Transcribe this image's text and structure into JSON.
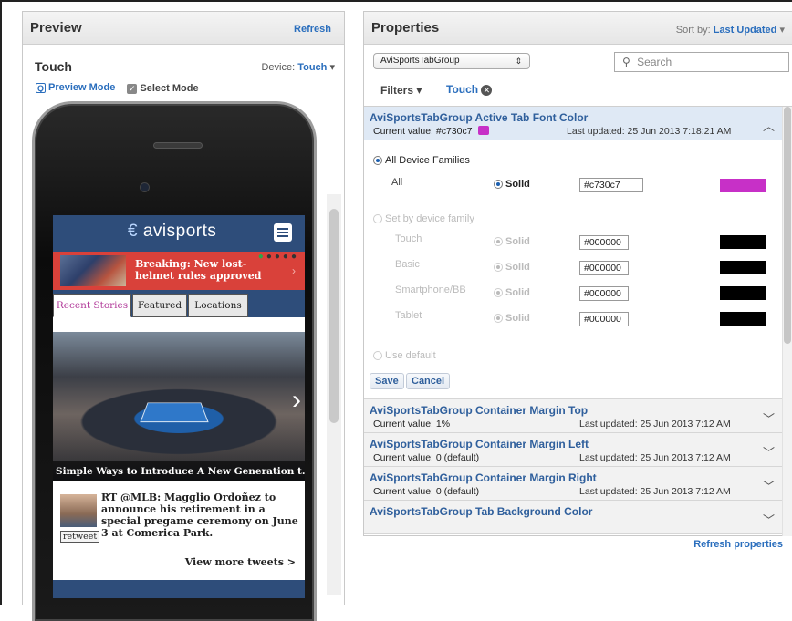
{
  "preview": {
    "title": "Preview",
    "refresh_label": "Refresh",
    "device_label": "Touch",
    "device_prefix": "Device:",
    "device_value": "Touch",
    "modes": [
      {
        "label": "Preview Mode"
      },
      {
        "label": "Select Mode"
      }
    ],
    "app": {
      "logo": "avisports",
      "breaking_text": "Breaking: New lost-helmet rules approved",
      "tabs": [
        "Recent Stories",
        "Featured",
        "Locations"
      ],
      "hero_caption": "Simple Ways to Introduce A New Generation t...",
      "tweet_text": "RT @MLB: Magglio Ordoñez to announce his retirement in a special pregame ceremony on June 3 at Comerica Park.",
      "retweet_label": "retweet",
      "more_tweets": "View more tweets >"
    }
  },
  "properties": {
    "title": "Properties",
    "sort_prefix": "Sort by:",
    "sort_value": "Last Updated",
    "tabgroup_select": "AviSportsTabGroup",
    "search_placeholder": "Search",
    "filters_label": "Filters",
    "filter_chip": "Touch",
    "expanded": {
      "name": "AviSportsTabGroup Active Tab Font Color",
      "current_prefix": "Current value:",
      "current_value": "#c730c7",
      "updated": "Last updated: 25 Jun 2013 7:18:21 AM",
      "all_families_label": "All Device Families",
      "all_label": "All",
      "solid_label": "Solid",
      "all_hex": "#c730c7",
      "all_color": "#c730c7",
      "set_by_family_label": "Set by device family",
      "families": [
        {
          "name": "Touch",
          "hex": "#000000"
        },
        {
          "name": "Basic",
          "hex": "#000000"
        },
        {
          "name": "Smartphone/BB",
          "hex": "#000000"
        },
        {
          "name": "Tablet",
          "hex": "#000000"
        }
      ],
      "use_default_label": "Use default",
      "save_label": "Save",
      "cancel_label": "Cancel"
    },
    "collapsed": [
      {
        "name": "AviSportsTabGroup Container Margin Top",
        "current": "Current value: 1%",
        "updated": "Last updated: 25 Jun 2013 7:12 AM"
      },
      {
        "name": "AviSportsTabGroup Container Margin Left",
        "current": "Current value: 0 (default)",
        "updated": "Last updated: 25 Jun 2013 7:12 AM"
      },
      {
        "name": "AviSportsTabGroup Container Margin Right",
        "current": "Current value: 0 (default)",
        "updated": "Last updated: 25 Jun 2013 7:12 AM"
      },
      {
        "name": "AviSportsTabGroup Tab Background Color",
        "current": "",
        "updated": ""
      }
    ],
    "refresh_props_label": "Refresh properties"
  },
  "colors": {
    "accent": "#2a6ebd",
    "app_blue": "#2e4d7a",
    "breaking_red": "#d9413a",
    "swatch_black": "#000000"
  },
  "icons": {
    "search": "search-icon",
    "preview_mode": "preview-mode-icon",
    "select_mode": "select-mode-icon",
    "chip_close": "close-icon"
  }
}
